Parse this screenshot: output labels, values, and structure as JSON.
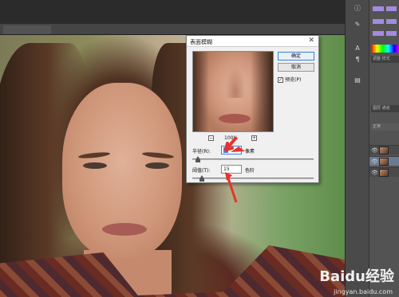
{
  "dialog": {
    "title": "表面模糊",
    "close_glyph": "✕",
    "ok_label": "确定",
    "cancel_label": "取消",
    "preview_label": "预览(P)",
    "preview_checked": true,
    "preview_check_glyph": "✓",
    "zoom_out_glyph": "−",
    "zoom_in_glyph": "+",
    "zoom_value": "100%",
    "radius": {
      "label": "半径(R):",
      "value": "5",
      "unit": "像素",
      "slider_fraction": 0.03
    },
    "threshold": {
      "label": "阈值(T):",
      "value": "15",
      "unit": "色阶",
      "slider_fraction": 0.06
    }
  },
  "right_panel": {
    "tab_adjust": "调整",
    "tab_style": "样式",
    "tab_layers": "图层",
    "tab_channels": "通道",
    "filter_label": "正常",
    "icons": [
      "info-icon",
      "brush-icon",
      "text-icon",
      "paragraph-icon",
      "history-icon"
    ]
  },
  "watermark": {
    "brand": "Baidu经验",
    "url": "jingyan.baidu.com"
  },
  "accent_color": "#e8322b"
}
